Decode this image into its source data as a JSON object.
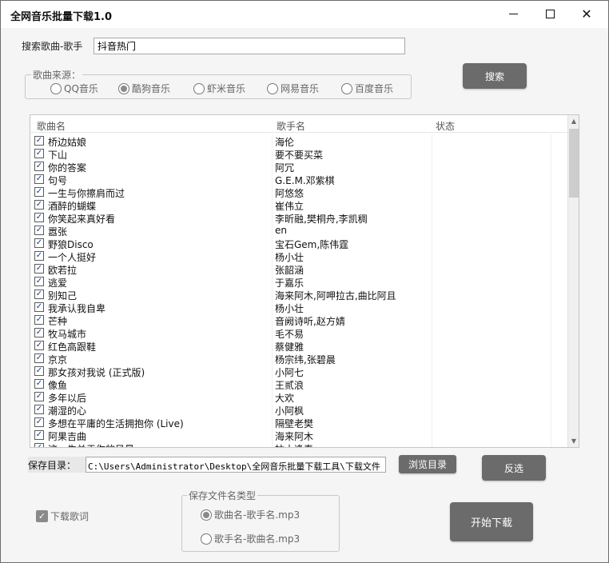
{
  "window": {
    "title": "全网音乐批量下载1.0",
    "minimize_glyph": "—",
    "maximize_glyph": "☐",
    "close_glyph": "✕"
  },
  "search": {
    "label": "搜索歌曲-歌手",
    "value": "抖音热门",
    "button_label": "搜索"
  },
  "source": {
    "legend": "歌曲来源：",
    "options": [
      {
        "label": "QQ音乐",
        "selected": false
      },
      {
        "label": "酷狗音乐",
        "selected": true
      },
      {
        "label": "虾米音乐",
        "selected": false
      },
      {
        "label": "网易音乐",
        "selected": false
      },
      {
        "label": "百度音乐",
        "selected": false
      }
    ]
  },
  "table": {
    "headers": [
      "歌曲名",
      "歌手名",
      "状态"
    ],
    "rows": [
      {
        "song": "桥边姑娘",
        "singer": "海伦",
        "checked": true
      },
      {
        "song": "下山",
        "singer": "要不要买菜",
        "checked": true
      },
      {
        "song": "你的答案",
        "singer": "阿冗",
        "checked": true
      },
      {
        "song": "句号",
        "singer": "G.E.M.邓紫棋",
        "checked": true
      },
      {
        "song": "一生与你擦肩而过",
        "singer": "阿悠悠",
        "checked": true
      },
      {
        "song": "酒醉的蝴蝶",
        "singer": "崔伟立",
        "checked": true
      },
      {
        "song": "你笑起来真好看",
        "singer": "李昕融,樊桐舟,李凯稠",
        "checked": true
      },
      {
        "song": "嚣张",
        "singer": "en",
        "checked": true
      },
      {
        "song": "野狼Disco",
        "singer": "宝石Gem,陈伟霆",
        "checked": true
      },
      {
        "song": "一个人挺好",
        "singer": "杨小壮",
        "checked": true
      },
      {
        "song": "欧若拉",
        "singer": "张韶涵",
        "checked": true
      },
      {
        "song": "逃爱",
        "singer": "于嘉乐",
        "checked": true
      },
      {
        "song": "别知己",
        "singer": "海来阿木,阿呷拉古,曲比阿且",
        "checked": true
      },
      {
        "song": "我承认我自卑",
        "singer": "杨小壮",
        "checked": true
      },
      {
        "song": "芒种",
        "singer": "音阙诗听,赵方婧",
        "checked": true
      },
      {
        "song": "牧马城市",
        "singer": "毛不易",
        "checked": true
      },
      {
        "song": "红色高跟鞋",
        "singer": "蔡健雅",
        "checked": true
      },
      {
        "song": "京京",
        "singer": "杨宗纬,张碧晨",
        "checked": true
      },
      {
        "song": "那女孩对我说 (正式版)",
        "singer": "小阿七",
        "checked": true
      },
      {
        "song": "像鱼",
        "singer": "王贰浪",
        "checked": true
      },
      {
        "song": "多年以后",
        "singer": "大欢",
        "checked": true
      },
      {
        "song": "潮湿的心",
        "singer": "小阿枫",
        "checked": true
      },
      {
        "song": "多想在平庸的生活拥抱你 (Live)",
        "singer": "隔壁老樊",
        "checked": true
      },
      {
        "song": "阿果吉曲",
        "singer": "海来阿木",
        "checked": true
      },
      {
        "song": "这一生关于你的风景",
        "singer": "枯木逢春",
        "checked": true
      }
    ],
    "scroll_up_glyph": "▲",
    "scroll_down_glyph": "▼",
    "check_glyph": "✓"
  },
  "save": {
    "label": "保存目录：",
    "path": "C:\\Users\\Administrator\\Desktop\\全网音乐批量下载工具\\下载文件",
    "browse_label": "浏览目录",
    "invert_label": "反选"
  },
  "lyrics": {
    "label": "下载歌词",
    "checked": true,
    "check_glyph": "✓"
  },
  "filename": {
    "legend": "保存文件名类型",
    "options": [
      {
        "label": "歌曲名-歌手名.mp3",
        "selected": true
      },
      {
        "label": "歌手名-歌曲名.mp3",
        "selected": false
      }
    ]
  },
  "start": {
    "label": "开始下载"
  },
  "colors": {
    "button_bg": "#6b6b6b",
    "window_bg": "#f5f5f5",
    "check_color": "#1a3d8f"
  }
}
